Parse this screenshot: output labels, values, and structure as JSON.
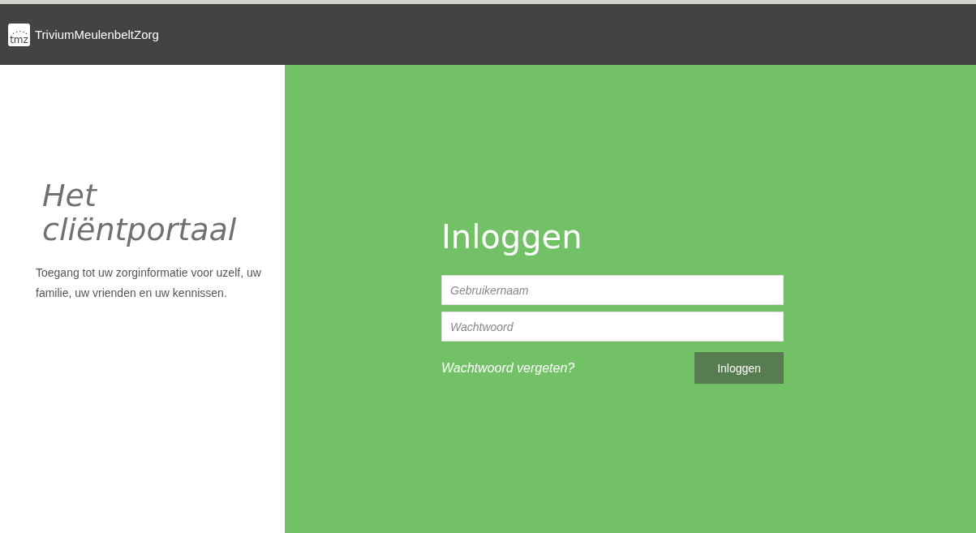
{
  "header": {
    "logo_text": "tmz",
    "brand": "TriviumMeulenbeltZorg"
  },
  "intro": {
    "title": "Het cliëntportaal",
    "text": "Toegang tot uw zorginformatie voor uzelf, uw familie, uw vrienden en uw kennissen."
  },
  "login": {
    "title": "Inloggen",
    "username": {
      "placeholder": "Gebruikernaam"
    },
    "password": {
      "placeholder": "Wachtwoord"
    },
    "forgot_link": "Wachtwoord vergeten?",
    "submit": "Inloggen"
  }
}
